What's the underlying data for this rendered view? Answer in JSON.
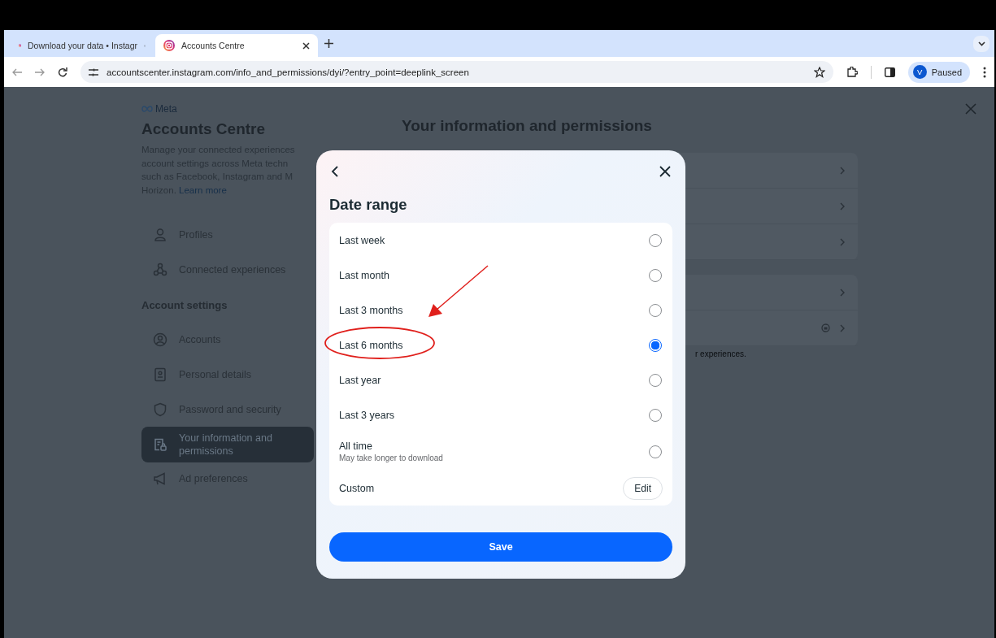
{
  "browser": {
    "tabs": [
      {
        "title": "Download your data • Instagr",
        "selected": false
      },
      {
        "title": "Accounts Centre",
        "selected": true
      }
    ],
    "url": "accountscenter.instagram.com/info_and_permissions/dyi/?entry_point=deeplink_screen",
    "profile": {
      "initial": "V",
      "status": "Paused"
    }
  },
  "sidebar": {
    "brand": "Meta",
    "title": "Accounts Centre",
    "description_lines": [
      "Manage your connected experiences",
      "account settings across Meta techn",
      "such as Facebook, Instagram and M",
      "Horizon."
    ],
    "learn_more": "Learn more",
    "groups": [
      {
        "items": [
          {
            "label": "Profiles",
            "selected": false
          },
          {
            "label": "Connected experiences",
            "selected": false
          }
        ]
      },
      {
        "heading": "Account settings",
        "items": [
          {
            "label": "Accounts",
            "selected": false
          },
          {
            "label": "Personal details",
            "selected": false
          },
          {
            "label": "Password and security",
            "selected": false
          },
          {
            "label": "Your information and permissions",
            "selected": true
          },
          {
            "label": "Ad preferences",
            "selected": false
          }
        ]
      }
    ]
  },
  "main": {
    "title": "Your information and permissions",
    "footnote": "r experiences."
  },
  "modal": {
    "title": "Date range",
    "options": [
      {
        "kind": "radio",
        "label": "Last week",
        "selected": false
      },
      {
        "kind": "radio",
        "label": "Last month",
        "selected": false
      },
      {
        "kind": "radio",
        "label": "Last 3 months",
        "selected": false
      },
      {
        "kind": "radio",
        "label": "Last 6 months",
        "selected": true
      },
      {
        "kind": "radio",
        "label": "Last year",
        "selected": false
      },
      {
        "kind": "radio",
        "label": "Last 3 years",
        "selected": false
      },
      {
        "kind": "radio",
        "label": "All time",
        "sublabel": "May take longer to download",
        "selected": false
      },
      {
        "kind": "action",
        "label": "Custom",
        "action": "Edit"
      }
    ],
    "save": "Save"
  }
}
